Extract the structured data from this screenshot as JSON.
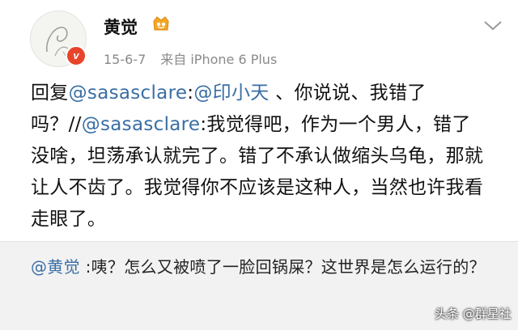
{
  "post": {
    "username": "黄觉",
    "verified_badge": "v",
    "vip_icon": "vip-crown-icon",
    "date": "15-6-7",
    "source": "来自 iPhone 6 Plus",
    "reply_prefix": "回复",
    "mention_1": "@sasasclare",
    "part_1": ":",
    "mention_2": "@印小天",
    "part_2": " 、你说说、我错了吗？//",
    "mention_3": "@sasasclare",
    "part_3": ":我觉得吧，作为一个男人，错了没啥，坦荡承认就完了。错了不承认做缩头乌龟，那就让人不齿了。我觉得你不应该是这种人，当然也许我看走眼了。"
  },
  "quote": {
    "mention": "@黄觉",
    "text": " :咦？怎么又被喷了一脸回锅屎？这世界是怎么运行的？"
  },
  "watermark": "头条 @群星社",
  "colors": {
    "link": "#3a6ea5",
    "badge": "#e8442c",
    "quote_bg": "#f2f2f2"
  }
}
